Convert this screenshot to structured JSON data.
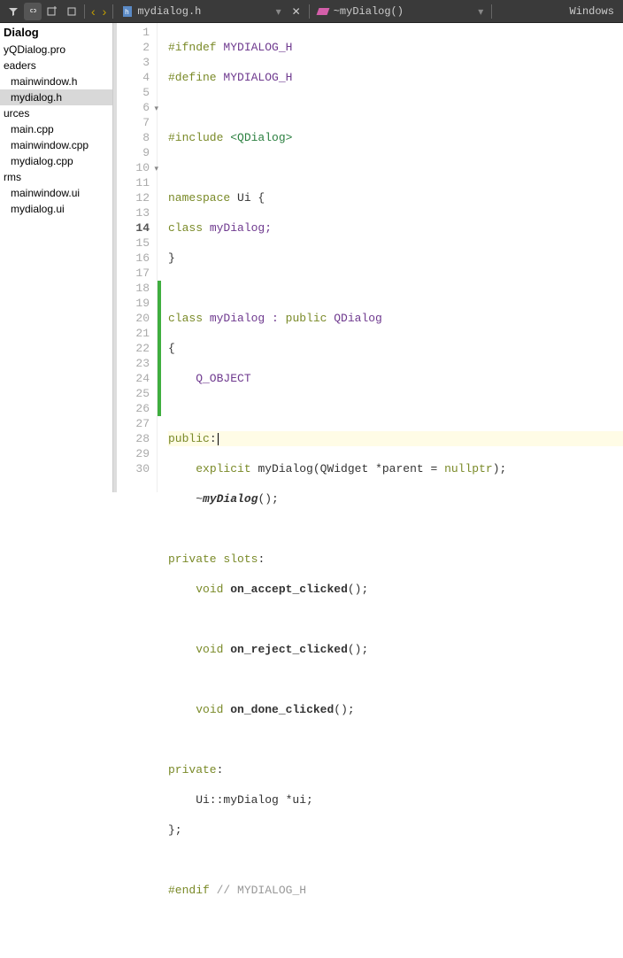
{
  "toolbar": {
    "tab_file": "mydialog.h",
    "breadcrumb_symbol": "~myDialog()",
    "encoding": "Windows"
  },
  "sidebar": {
    "header": "Dialog",
    "project": "yQDialog.pro",
    "grp_headers": "eaders",
    "hdr1": "mainwindow.h",
    "hdr2": "mydialog.h",
    "grp_sources": "urces",
    "src1": "main.cpp",
    "src2": "mainwindow.cpp",
    "src3": "mydialog.cpp",
    "grp_forms": "rms",
    "frm1": "mainwindow.ui",
    "frm2": "mydialog.ui"
  },
  "code": {
    "l1a": "#ifndef",
    "l1b": " MYDIALOG_H",
    "l2a": "#define",
    "l2b": " MYDIALOG_H",
    "l4a": "#include",
    "l4b": " <QDialog>",
    "l6a": "namespace",
    "l6b": " Ui {",
    "l7a": "class",
    "l7b": " myDialog;",
    "l8": "}",
    "l10a": "class",
    "l10b": " myDialog : ",
    "l10c": "public",
    "l10d": " QDialog",
    "l11": "{",
    "l12": "    Q_OBJECT",
    "l14a": "public",
    "l14b": ":",
    "l15a": "    ",
    "l15b": "explicit",
    "l15c": " myDialog(QWidget *parent = ",
    "l15d": "nullptr",
    "l15e": ");",
    "l16a": "    ~",
    "l16b": "myDialog",
    "l16c": "();",
    "l18a": "private",
    "l18b": " ",
    "l18c": "slots",
    "l18d": ":",
    "l19a": "    ",
    "l19b": "void",
    "l19c": " ",
    "l19d": "on_accept_clicked",
    "l19e": "();",
    "l21a": "    ",
    "l21b": "void",
    "l21c": " ",
    "l21d": "on_reject_clicked",
    "l21e": "();",
    "l23a": "    ",
    "l23b": "void",
    "l23c": " ",
    "l23d": "on_done_clicked",
    "l23e": "();",
    "l25a": "private",
    "l25b": ":",
    "l26": "    Ui::myDialog *ui;",
    "l27": "};",
    "l29a": "#endif",
    "l29b": " ",
    "l29c": "// MYDIALOG_H"
  },
  "lines": [
    "1",
    "2",
    "3",
    "4",
    "5",
    "6",
    "7",
    "8",
    "9",
    "10",
    "11",
    "12",
    "13",
    "14",
    "15",
    "16",
    "17",
    "18",
    "19",
    "20",
    "21",
    "22",
    "23",
    "24",
    "25",
    "26",
    "27",
    "28",
    "29",
    "30"
  ]
}
